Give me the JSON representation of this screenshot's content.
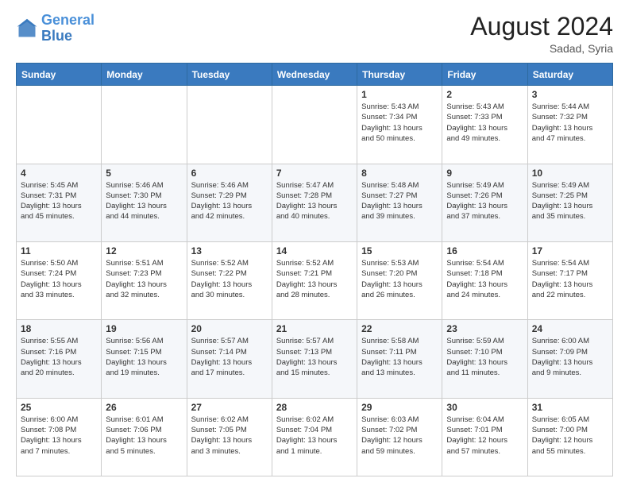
{
  "logo": {
    "line1": "General",
    "line2": "Blue"
  },
  "title": "August 2024",
  "subtitle": "Sadad, Syria",
  "weekdays": [
    "Sunday",
    "Monday",
    "Tuesday",
    "Wednesday",
    "Thursday",
    "Friday",
    "Saturday"
  ],
  "weeks": [
    [
      {
        "day": "",
        "info": ""
      },
      {
        "day": "",
        "info": ""
      },
      {
        "day": "",
        "info": ""
      },
      {
        "day": "",
        "info": ""
      },
      {
        "day": "1",
        "info": "Sunrise: 5:43 AM\nSunset: 7:34 PM\nDaylight: 13 hours\nand 50 minutes."
      },
      {
        "day": "2",
        "info": "Sunrise: 5:43 AM\nSunset: 7:33 PM\nDaylight: 13 hours\nand 49 minutes."
      },
      {
        "day": "3",
        "info": "Sunrise: 5:44 AM\nSunset: 7:32 PM\nDaylight: 13 hours\nand 47 minutes."
      }
    ],
    [
      {
        "day": "4",
        "info": "Sunrise: 5:45 AM\nSunset: 7:31 PM\nDaylight: 13 hours\nand 45 minutes."
      },
      {
        "day": "5",
        "info": "Sunrise: 5:46 AM\nSunset: 7:30 PM\nDaylight: 13 hours\nand 44 minutes."
      },
      {
        "day": "6",
        "info": "Sunrise: 5:46 AM\nSunset: 7:29 PM\nDaylight: 13 hours\nand 42 minutes."
      },
      {
        "day": "7",
        "info": "Sunrise: 5:47 AM\nSunset: 7:28 PM\nDaylight: 13 hours\nand 40 minutes."
      },
      {
        "day": "8",
        "info": "Sunrise: 5:48 AM\nSunset: 7:27 PM\nDaylight: 13 hours\nand 39 minutes."
      },
      {
        "day": "9",
        "info": "Sunrise: 5:49 AM\nSunset: 7:26 PM\nDaylight: 13 hours\nand 37 minutes."
      },
      {
        "day": "10",
        "info": "Sunrise: 5:49 AM\nSunset: 7:25 PM\nDaylight: 13 hours\nand 35 minutes."
      }
    ],
    [
      {
        "day": "11",
        "info": "Sunrise: 5:50 AM\nSunset: 7:24 PM\nDaylight: 13 hours\nand 33 minutes."
      },
      {
        "day": "12",
        "info": "Sunrise: 5:51 AM\nSunset: 7:23 PM\nDaylight: 13 hours\nand 32 minutes."
      },
      {
        "day": "13",
        "info": "Sunrise: 5:52 AM\nSunset: 7:22 PM\nDaylight: 13 hours\nand 30 minutes."
      },
      {
        "day": "14",
        "info": "Sunrise: 5:52 AM\nSunset: 7:21 PM\nDaylight: 13 hours\nand 28 minutes."
      },
      {
        "day": "15",
        "info": "Sunrise: 5:53 AM\nSunset: 7:20 PM\nDaylight: 13 hours\nand 26 minutes."
      },
      {
        "day": "16",
        "info": "Sunrise: 5:54 AM\nSunset: 7:18 PM\nDaylight: 13 hours\nand 24 minutes."
      },
      {
        "day": "17",
        "info": "Sunrise: 5:54 AM\nSunset: 7:17 PM\nDaylight: 13 hours\nand 22 minutes."
      }
    ],
    [
      {
        "day": "18",
        "info": "Sunrise: 5:55 AM\nSunset: 7:16 PM\nDaylight: 13 hours\nand 20 minutes."
      },
      {
        "day": "19",
        "info": "Sunrise: 5:56 AM\nSunset: 7:15 PM\nDaylight: 13 hours\nand 19 minutes."
      },
      {
        "day": "20",
        "info": "Sunrise: 5:57 AM\nSunset: 7:14 PM\nDaylight: 13 hours\nand 17 minutes."
      },
      {
        "day": "21",
        "info": "Sunrise: 5:57 AM\nSunset: 7:13 PM\nDaylight: 13 hours\nand 15 minutes."
      },
      {
        "day": "22",
        "info": "Sunrise: 5:58 AM\nSunset: 7:11 PM\nDaylight: 13 hours\nand 13 minutes."
      },
      {
        "day": "23",
        "info": "Sunrise: 5:59 AM\nSunset: 7:10 PM\nDaylight: 13 hours\nand 11 minutes."
      },
      {
        "day": "24",
        "info": "Sunrise: 6:00 AM\nSunset: 7:09 PM\nDaylight: 13 hours\nand 9 minutes."
      }
    ],
    [
      {
        "day": "25",
        "info": "Sunrise: 6:00 AM\nSunset: 7:08 PM\nDaylight: 13 hours\nand 7 minutes."
      },
      {
        "day": "26",
        "info": "Sunrise: 6:01 AM\nSunset: 7:06 PM\nDaylight: 13 hours\nand 5 minutes."
      },
      {
        "day": "27",
        "info": "Sunrise: 6:02 AM\nSunset: 7:05 PM\nDaylight: 13 hours\nand 3 minutes."
      },
      {
        "day": "28",
        "info": "Sunrise: 6:02 AM\nSunset: 7:04 PM\nDaylight: 13 hours\nand 1 minute."
      },
      {
        "day": "29",
        "info": "Sunrise: 6:03 AM\nSunset: 7:02 PM\nDaylight: 12 hours\nand 59 minutes."
      },
      {
        "day": "30",
        "info": "Sunrise: 6:04 AM\nSunset: 7:01 PM\nDaylight: 12 hours\nand 57 minutes."
      },
      {
        "day": "31",
        "info": "Sunrise: 6:05 AM\nSunset: 7:00 PM\nDaylight: 12 hours\nand 55 minutes."
      }
    ]
  ]
}
